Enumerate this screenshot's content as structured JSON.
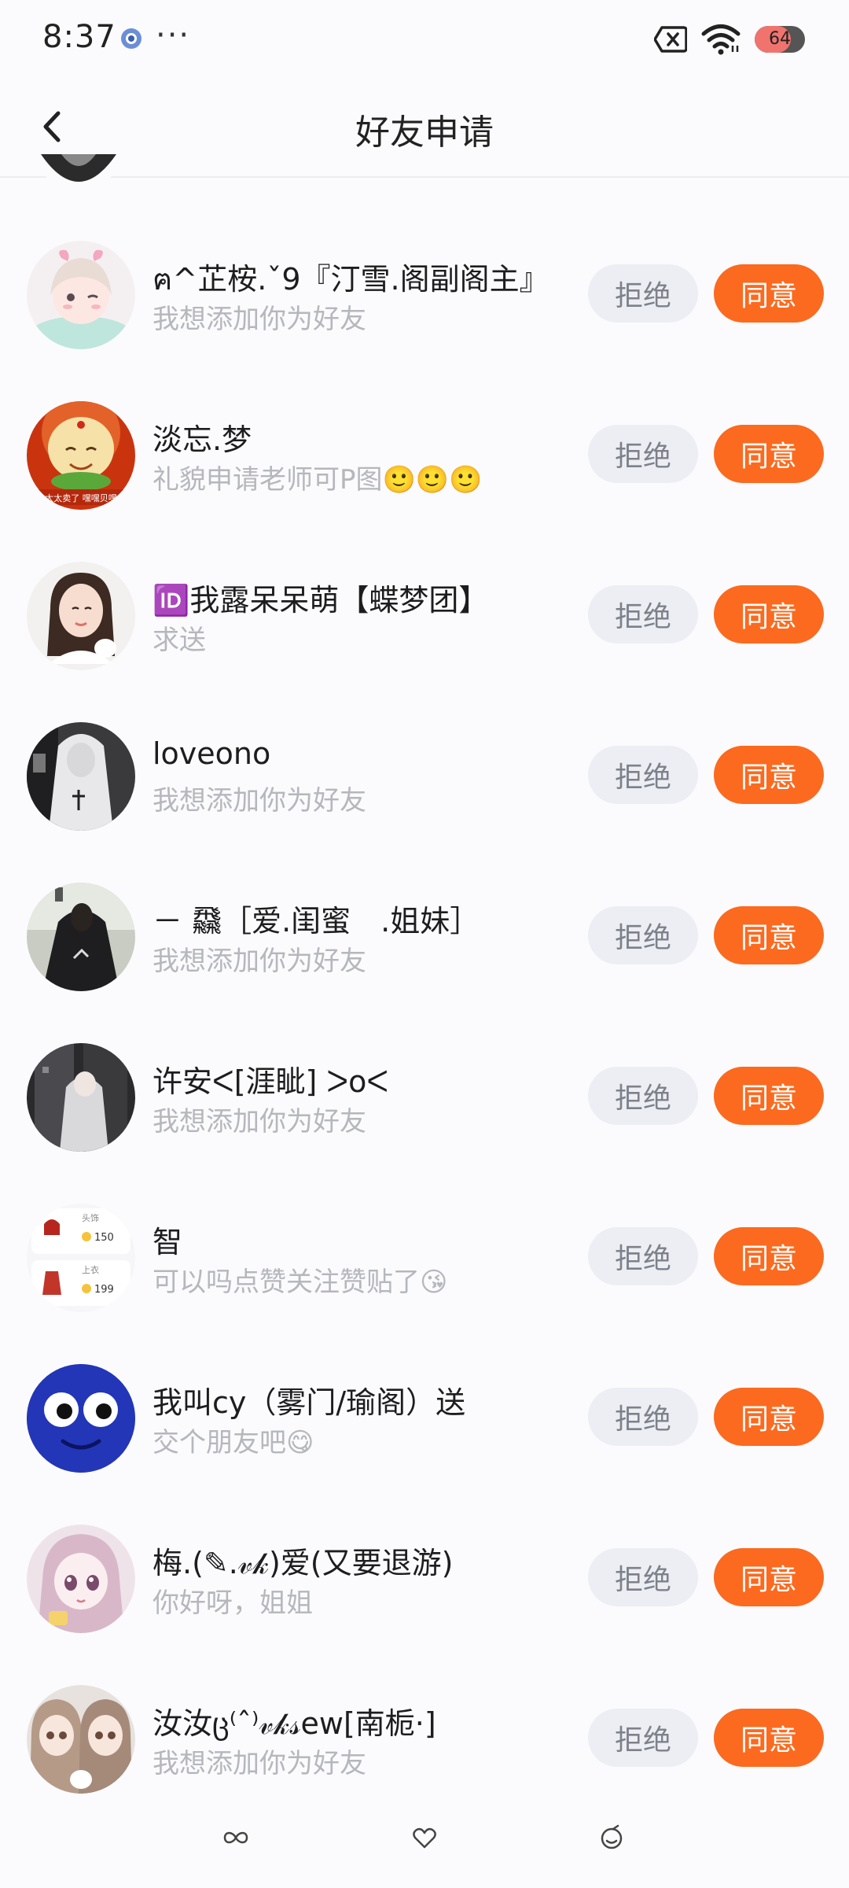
{
  "status_bar": {
    "time": "8:37",
    "more": "···",
    "battery": "64"
  },
  "header": {
    "title": "好友申请"
  },
  "requests": [
    {
      "name": "ฅ^芷桉.ˇ9『汀雪.阁副阁主』",
      "message": "我想添加你为好友",
      "reject": "拒绝",
      "agree": "同意"
    },
    {
      "name": "淡忘.梦",
      "message": "礼貌申请老师可P图🙂🙂🙂",
      "reject": "拒绝",
      "agree": "同意"
    },
    {
      "name": "🆔我露呆呆萌【蝶梦团】",
      "message": "求送",
      "reject": "拒绝",
      "agree": "同意"
    },
    {
      "name": "loveono",
      "message": "我想添加你为好友",
      "reject": "拒绝",
      "agree": "同意"
    },
    {
      "name": "－ 飝［爱.闺蜜　.姐妹］",
      "message": "我想添加你为好友",
      "reject": "拒绝",
      "agree": "同意"
    },
    {
      "name": "许安ᐸ[涯眦] ᐳoᐸ",
      "message": "我想添加你为好友",
      "reject": "拒绝",
      "agree": "同意"
    },
    {
      "name": "智",
      "message": "可以吗点赞关注赞贴了😘",
      "reject": "拒绝",
      "agree": "同意"
    },
    {
      "name": "我叫cy（雾门/瑜阁）送",
      "message": "交个朋友吧😋",
      "reject": "拒绝",
      "agree": "同意"
    },
    {
      "name": "梅.(✎.𝓋𝓀)爱(又要退游)",
      "message": "你好呀，姐姐",
      "reject": "拒绝",
      "agree": "同意"
    },
    {
      "name": "汝汝ც⁽ˆ⁾𝓋𝓀𝓈ew[南栀·]",
      "message": "我想添加你为好友",
      "reject": "拒绝",
      "agree": "同意"
    }
  ],
  "avatar7": {
    "item1_label": "头饰",
    "item1_price": "150",
    "item2_label": "上衣",
    "item2_price": "199"
  },
  "avatar2_caption": "太太卖了 嘿嘿贝嘿",
  "colors": {
    "agree_bg": "#fb6a1f",
    "reject_bg": "#eceef4",
    "message_text": "#b6b7bc"
  },
  "icons": [
    "back-arrow-icon",
    "app-notification-icon",
    "mute-icon",
    "wifi-icon",
    "battery-icon",
    "infinity-icon",
    "heart-icon",
    "smile-icon"
  ]
}
